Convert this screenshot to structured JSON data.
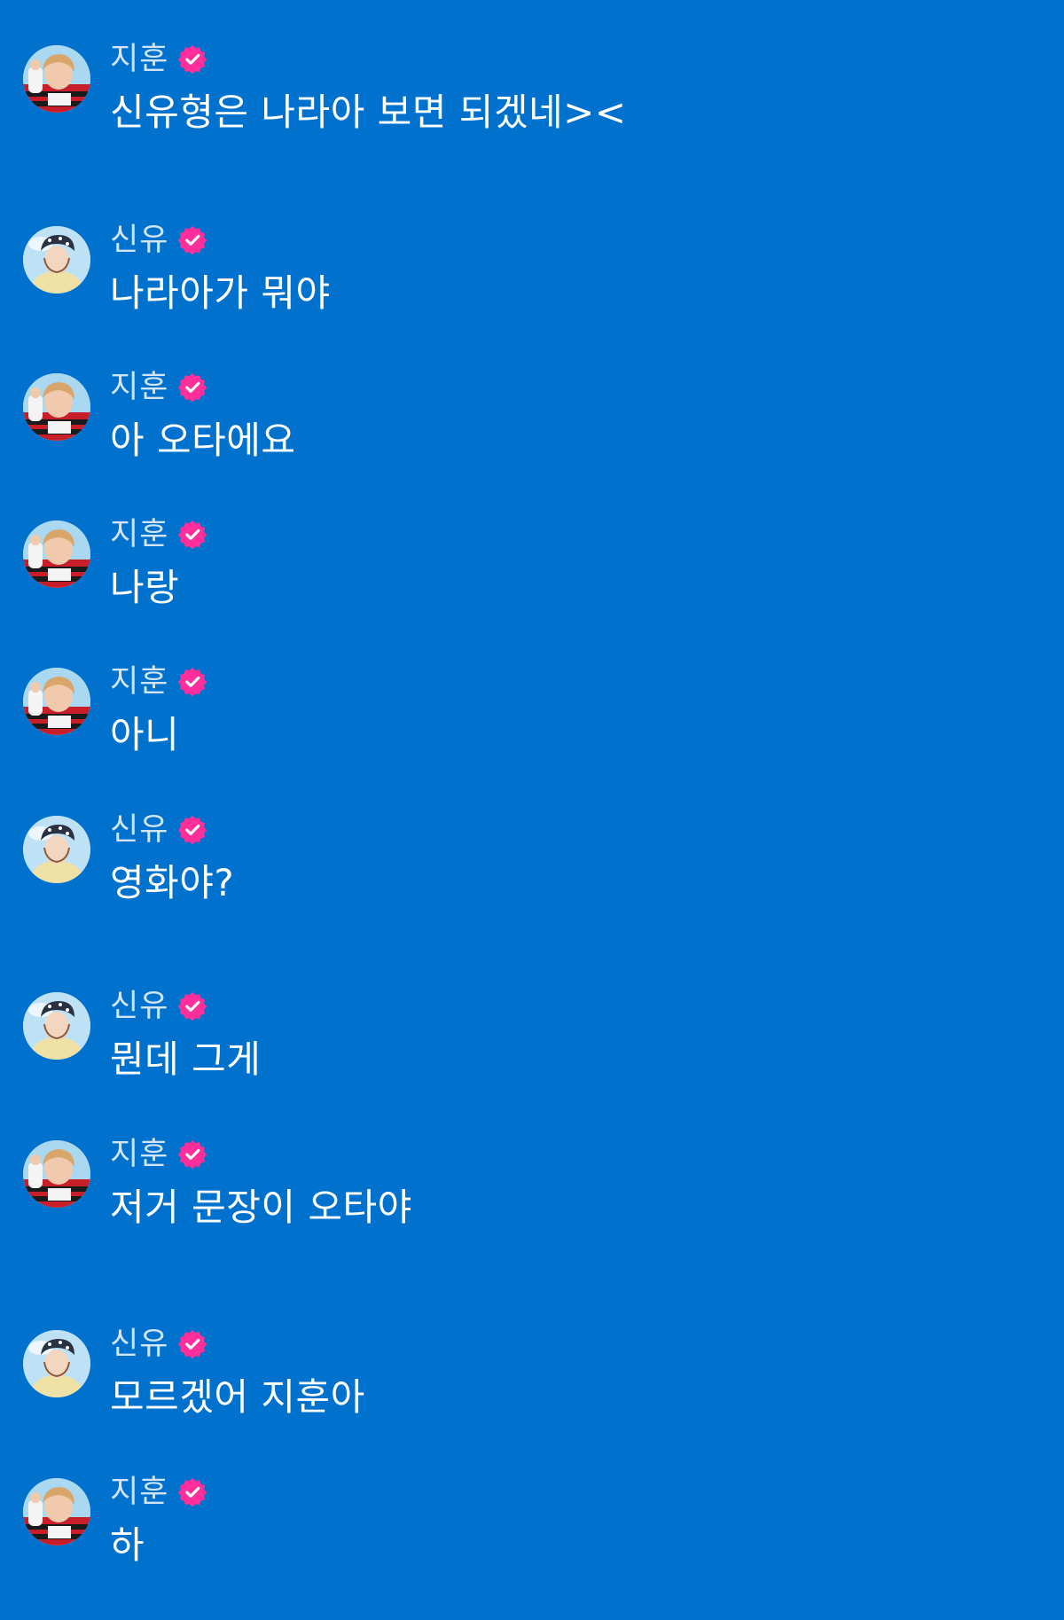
{
  "colors": {
    "background": "#0071CC",
    "badge": "#FF2E9A",
    "text": "#FFFFFF"
  },
  "messages": [
    {
      "sender": "지훈",
      "avatar": "avatar-jihoon",
      "text": "신유형은 나라아 보면 되겠네><"
    },
    {
      "sender": "신유",
      "avatar": "avatar-shinyu",
      "text": "나라아가 뭐야"
    },
    {
      "sender": "지훈",
      "avatar": "avatar-jihoon",
      "text": "아 오타에요"
    },
    {
      "sender": "지훈",
      "avatar": "avatar-jihoon",
      "text": "나랑"
    },
    {
      "sender": "지훈",
      "avatar": "avatar-jihoon",
      "text": "아니"
    },
    {
      "sender": "신유",
      "avatar": "avatar-shinyu",
      "text": "영화야?"
    },
    {
      "sender": "신유",
      "avatar": "avatar-shinyu",
      "text": "뭔데 그게"
    },
    {
      "sender": "지훈",
      "avatar": "avatar-jihoon",
      "text": "저거 문장이 오타야"
    },
    {
      "sender": "신유",
      "avatar": "avatar-shinyu",
      "text": "모르겠어 지훈아"
    },
    {
      "sender": "지훈",
      "avatar": "avatar-jihoon",
      "text": "하"
    }
  ]
}
